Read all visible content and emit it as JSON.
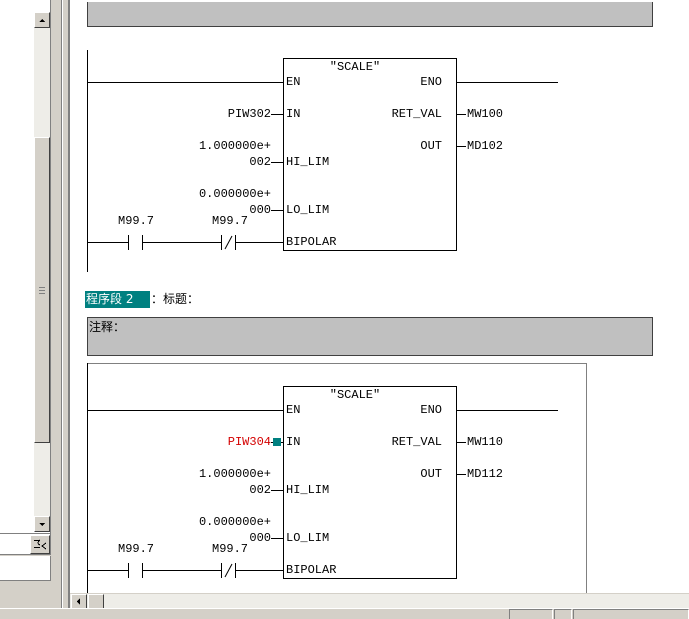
{
  "colors": {
    "network_label_highlight": "#008080",
    "network_label_text": "#ffffff",
    "invalid_operand": "#d40000",
    "cursor": "#008080",
    "comment_box_fill": "#c0c0c0",
    "window_gray": "#d4d0c8"
  },
  "icons": {
    "no_contact": "normally-open-contact-icon",
    "nc_contact": "normally-closed-contact-icon",
    "scroll_up": "scroll-up-arrow-icon",
    "scroll_down": "scroll-down-arrow-icon",
    "scroll_left": "scroll-left-arrow-icon",
    "panel_tool": "panel-tool-icon"
  },
  "networks": [
    {
      "block_name": "\"SCALE\"",
      "input_pins": [
        "EN",
        "IN",
        "HI_LIM",
        "LO_LIM",
        "BIPOLAR"
      ],
      "output_pins": [
        "ENO",
        "RET_VAL",
        "OUT"
      ],
      "in_operand": "PIW302",
      "hi_lim_operand_line1": "1.000000e+",
      "hi_lim_operand_line2": "002",
      "lo_lim_operand_line1": "0.000000e+",
      "lo_lim_operand_line2": "000",
      "ret_val_operand": "MW100",
      "out_operand": "MD102",
      "contacts": [
        {
          "address": "M99.7",
          "icon": "normally-open-contact-icon"
        },
        {
          "address": "M99.7",
          "icon": "normally-closed-contact-icon"
        }
      ]
    },
    {
      "label": "程序段 2",
      "title_caption": "：标题：",
      "comment_caption": "注释：",
      "block_name": "\"SCALE\"",
      "input_pins": [
        "EN",
        "IN",
        "HI_LIM",
        "LO_LIM",
        "BIPOLAR"
      ],
      "output_pins": [
        "ENO",
        "RET_VAL",
        "OUT"
      ],
      "in_operand": "PIW304",
      "hi_lim_operand_line1": "1.000000e+",
      "hi_lim_operand_line2": "002",
      "lo_lim_operand_line1": "0.000000e+",
      "lo_lim_operand_line2": "000",
      "ret_val_operand": "MW110",
      "out_operand": "MD112",
      "contacts": [
        {
          "address": "M99.7",
          "icon": "normally-open-contact-icon"
        },
        {
          "address": "M99.7",
          "icon": "normally-closed-contact-icon"
        }
      ]
    }
  ]
}
